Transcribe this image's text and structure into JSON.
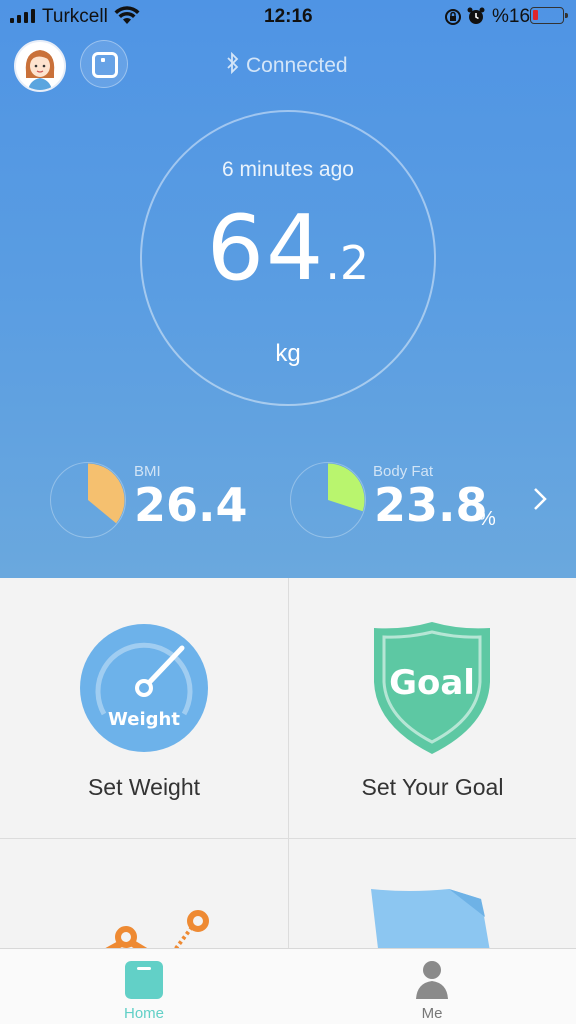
{
  "status_bar": {
    "carrier": "Turkcell",
    "time": "12:16",
    "battery_percent": "%16",
    "battery_level": 0.16
  },
  "header": {
    "connection_status": "Connected"
  },
  "measurement": {
    "time_ago": "6 minutes ago",
    "weight_integer": "64",
    "weight_decimal": ".2",
    "unit": "kg"
  },
  "stats": [
    {
      "label": "BMI",
      "value": "26.4",
      "unit": "",
      "fraction": 0.36,
      "color": "#f5c06f"
    },
    {
      "label": "Body Fat",
      "value": "23.8",
      "unit": "%",
      "fraction": 0.3,
      "color": "#b9f56e"
    }
  ],
  "actions": {
    "set_weight": {
      "label": "Set Weight",
      "icon_text": "Weight"
    },
    "set_goal": {
      "label": "Set Your Goal",
      "icon_text": "Goal"
    }
  },
  "tabbar": {
    "home": "Home",
    "me": "Me"
  },
  "colors": {
    "accent": "#4f94e4",
    "teal": "#62d0c7",
    "goal_green": "#5dc8a3"
  }
}
